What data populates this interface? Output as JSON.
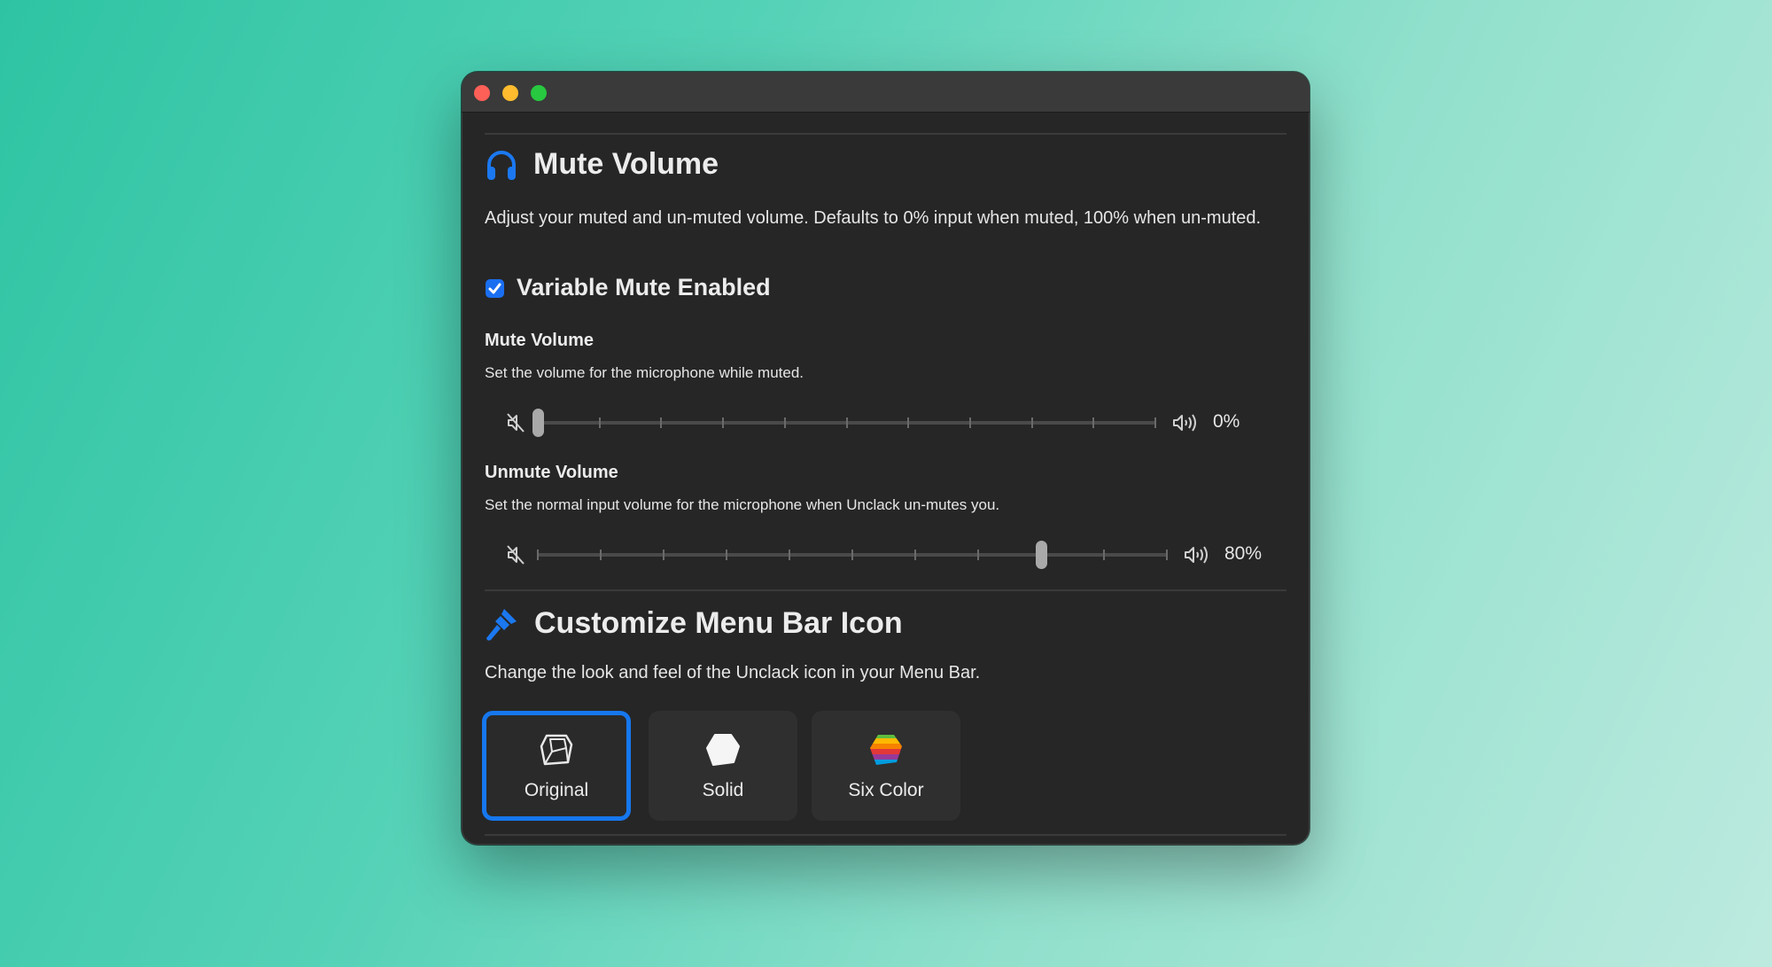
{
  "window": {
    "traffic_lights": {
      "close_color": "#fe5f57",
      "minimize_color": "#febc2e",
      "maximize_color": "#28c840"
    }
  },
  "mute_section": {
    "icon": "headphones-icon",
    "title": "Mute Volume",
    "description": "Adjust your muted and un-muted volume. Defaults to 0% input when muted, 100% when un-muted.",
    "checkbox": {
      "label": "Variable Mute Enabled",
      "checked": true
    },
    "mute_volume": {
      "title": "Mute Volume",
      "description": "Set the volume for the microphone while muted.",
      "value": 0,
      "value_label": "0%"
    },
    "unmute_volume": {
      "title": "Unmute Volume",
      "description": "Set the normal input volume for the microphone when Unclack un-mutes you.",
      "value": 80,
      "value_label": "80%"
    }
  },
  "customize_section": {
    "icon": "paintbrush-icon",
    "title": "Customize Menu Bar Icon",
    "description": "Change the look and feel of the Unclack icon in your Menu Bar.",
    "options": [
      {
        "label": "Original",
        "icon": "keycap-outline-icon",
        "selected": true
      },
      {
        "label": "Solid",
        "icon": "keycap-solid-icon",
        "selected": false
      },
      {
        "label": "Six Color",
        "icon": "keycap-six-color-icon",
        "selected": false
      }
    ]
  },
  "colors": {
    "accent": "#1677ee",
    "window_background": "#262626"
  }
}
